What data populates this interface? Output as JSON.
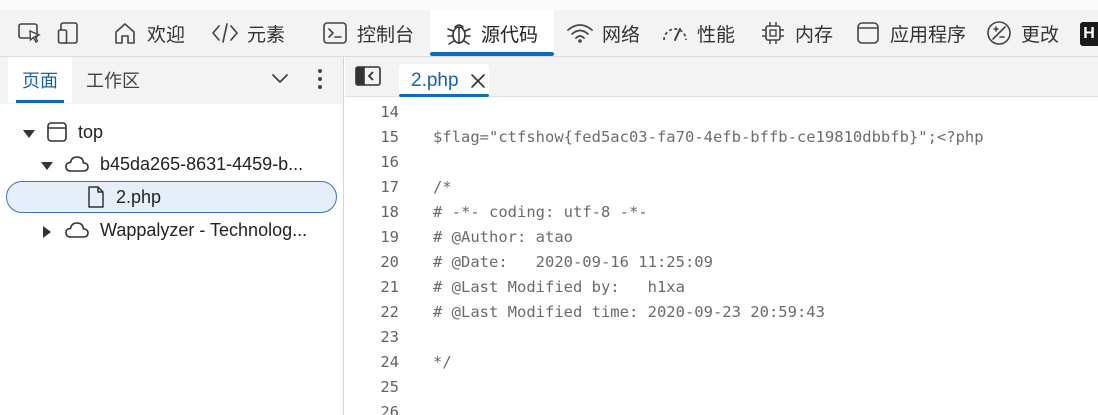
{
  "toolbar": {
    "items": [
      {
        "label": "",
        "icon": "inspect-icon"
      },
      {
        "label": "",
        "icon": "device-emulation-icon"
      },
      {
        "label": "欢迎",
        "icon": "home-icon"
      },
      {
        "label": "元素",
        "icon": "code-tag-icon"
      },
      {
        "label": "控制台",
        "icon": "console-icon"
      },
      {
        "label": "源代码",
        "icon": "bug-icon"
      },
      {
        "label": "网络",
        "icon": "wifi-icon"
      },
      {
        "label": "性能",
        "icon": "performance-icon"
      },
      {
        "label": "内存",
        "icon": "chip-icon"
      },
      {
        "label": "应用程序",
        "icon": "application-icon"
      },
      {
        "label": "更改",
        "icon": "changes-icon"
      }
    ],
    "active": "源代码",
    "accent": "#0f6cbd"
  },
  "left_panel": {
    "tabs": [
      "页面",
      "工作区"
    ],
    "active_tab": "页面",
    "tree": [
      {
        "label": "top",
        "icon": "frame-icon",
        "expanded": true
      },
      {
        "label": "b45da265-8631-4459-b...",
        "icon": "cloud-icon",
        "expanded": true
      },
      {
        "label": "2.php",
        "icon": "file-icon",
        "selected": true
      },
      {
        "label": "Wappalyzer - Technolog...",
        "icon": "cloud-icon",
        "expanded": false
      }
    ]
  },
  "editor": {
    "tab_label": "2.php",
    "lines": [
      {
        "n": "14",
        "text": ""
      },
      {
        "n": "15",
        "text": "$flag=\"ctfshow{fed5ac03-fa70-4efb-bffb-ce19810dbbfb}\";<?php"
      },
      {
        "n": "16",
        "text": ""
      },
      {
        "n": "17",
        "text": "/*"
      },
      {
        "n": "18",
        "text": "# -*- coding: utf-8 -*-"
      },
      {
        "n": "19",
        "text": "# @Author: atao"
      },
      {
        "n": "20",
        "text": "# @Date:   2020-09-16 11:25:09"
      },
      {
        "n": "21",
        "text": "# @Last Modified by:   h1xa"
      },
      {
        "n": "22",
        "text": "# @Last Modified time: 2020-09-23 20:59:43"
      },
      {
        "n": "23",
        "text": ""
      },
      {
        "n": "24",
        "text": "*/"
      },
      {
        "n": "25",
        "text": ""
      },
      {
        "n": "26",
        "text": ""
      }
    ]
  }
}
